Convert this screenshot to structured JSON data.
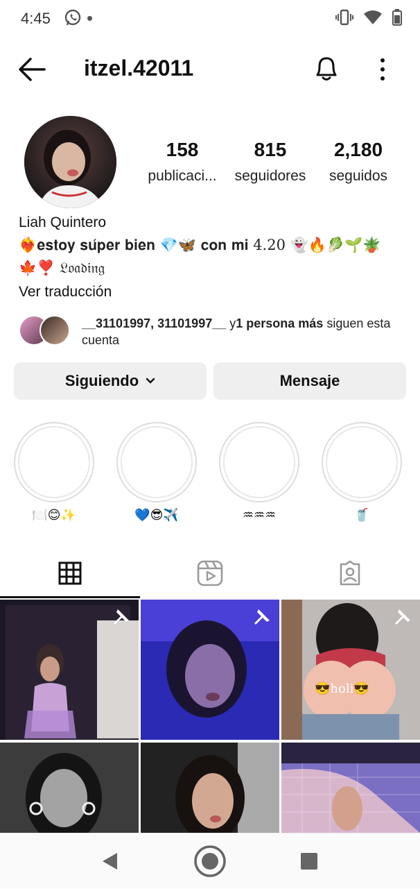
{
  "status": {
    "time": "4:45"
  },
  "header": {
    "username": "itzel.42011"
  },
  "stats": [
    {
      "value": "158",
      "label": "publicaci..."
    },
    {
      "value": "815",
      "label": "seguidores"
    },
    {
      "value": "2,180",
      "label": "seguidos"
    }
  ],
  "bio": {
    "name": "Liah Quintero",
    "line1": "❤️‍🔥𝐞𝐬𝐭𝐨𝐲 𝐬𝐮́𝐩𝐞𝐫 𝐛𝐢𝐞𝐧 💎🦋 𝐜𝐨𝐧 𝐦𝐢 4.20 👻🔥🥬🌱🪴",
    "line2": "🍁❣️ 𝔏𝔬𝔞𝔡𝔦𝔫𝔤",
    "translate": "Ver traducción"
  },
  "followed_by": {
    "names": "__31101997, 31101997__",
    "connector": " y",
    "more": "1 persona más",
    "suffix": " siguen esta cuenta"
  },
  "buttons": {
    "following": "Siguiendo",
    "message": "Mensaje"
  },
  "highlights": [
    {
      "caption": "🍽️😊✨"
    },
    {
      "caption": "💙😎✈️"
    },
    {
      "caption": "♒♒♒"
    },
    {
      "caption": "🥤"
    }
  ],
  "grid_overlay": {
    "post3_caption": "😎holi😎"
  },
  "colors": {
    "accent": "#111111",
    "button_bg": "#efefef",
    "ring": "#dddddd"
  }
}
